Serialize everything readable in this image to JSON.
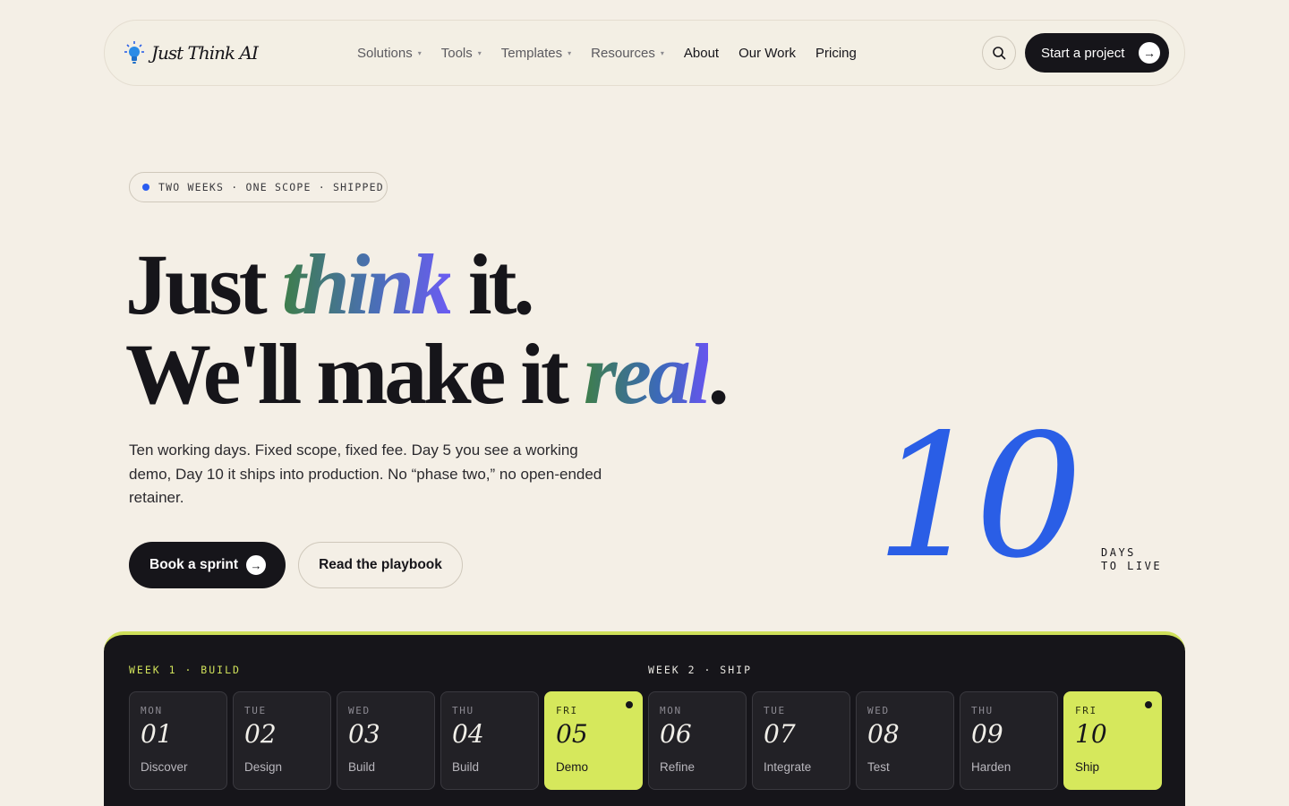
{
  "nav": {
    "brand": "Just Think AI",
    "menu": [
      {
        "label": "Solutions",
        "has_caret": true
      },
      {
        "label": "Tools",
        "has_caret": true
      },
      {
        "label": "Templates",
        "has_caret": true
      },
      {
        "label": "Resources",
        "has_caret": true
      },
      {
        "label": "About",
        "has_caret": false
      },
      {
        "label": "Our Work",
        "has_caret": false
      },
      {
        "label": "Pricing",
        "has_caret": false
      }
    ],
    "cta_label": "Start a project",
    "cta_icon": "arrow-right-icon",
    "search_icon": "search-icon"
  },
  "hero": {
    "badge": "TWO WEEKS · ONE SCOPE · SHIPPED",
    "headline": {
      "l1_a": "Just ",
      "l1_accent": "think",
      "l1_b": " it.",
      "l2_a": "We'll make it ",
      "l2_accent": "real",
      "l2_b": "."
    },
    "lede": "Ten working days. Fixed scope, fixed fee. Day 5 you see a working demo, Day 10 it ships into production. No “phase two,” no open-ended retainer.",
    "primary_button": "Book a sprint",
    "secondary_button": "Read the playbook",
    "big_number": "10",
    "big_label_1": "DAYS",
    "big_label_2": "TO LIVE"
  },
  "timeline": {
    "week1": "WEEK 1 · BUILD",
    "week2": "WEEK 2 · SHIP",
    "days": [
      {
        "day": "MON",
        "num": "01",
        "task": "Discover",
        "highlight": false
      },
      {
        "day": "TUE",
        "num": "02",
        "task": "Design",
        "highlight": false
      },
      {
        "day": "WED",
        "num": "03",
        "task": "Build",
        "highlight": false
      },
      {
        "day": "THU",
        "num": "04",
        "task": "Build",
        "highlight": false
      },
      {
        "day": "FRI",
        "num": "05",
        "task": "Demo",
        "highlight": true
      },
      {
        "day": "MON",
        "num": "06",
        "task": "Refine",
        "highlight": false
      },
      {
        "day": "TUE",
        "num": "07",
        "task": "Integrate",
        "highlight": false
      },
      {
        "day": "WED",
        "num": "08",
        "task": "Test",
        "highlight": false
      },
      {
        "day": "THU",
        "num": "09",
        "task": "Harden",
        "highlight": false
      },
      {
        "day": "FRI",
        "num": "10",
        "task": "Ship",
        "highlight": true
      }
    ]
  },
  "colors": {
    "background": "#f4efe6",
    "ink": "#16151a",
    "accent_blue": "#2a5ee6",
    "accent_lime": "#d6e85c"
  }
}
